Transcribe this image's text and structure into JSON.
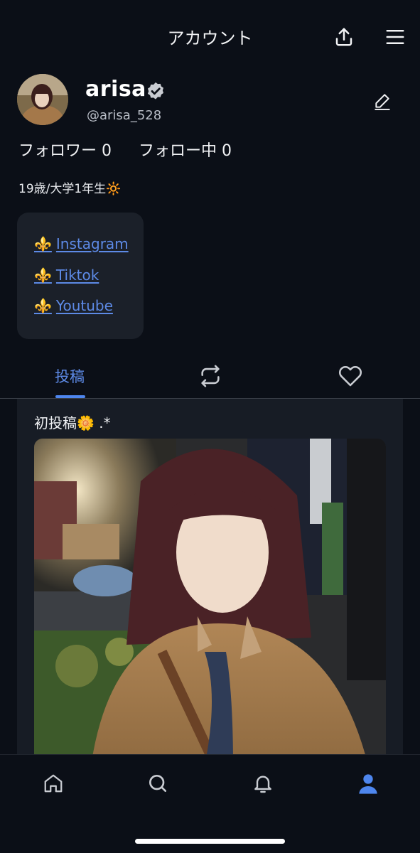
{
  "header": {
    "title": "アカウント"
  },
  "profile": {
    "display_name": "arisa",
    "username": "@arisa_528",
    "followers_label": "フォロワー 0",
    "following_label": "フォロー中 0",
    "bio": "19歳/大学1年生🔆"
  },
  "links": {
    "fleur": "⚜️",
    "items": [
      {
        "label": "Instagram"
      },
      {
        "label": "Tiktok"
      },
      {
        "label": "Youtube"
      }
    ]
  },
  "tabs": {
    "posts_label": "投稿"
  },
  "post": {
    "text": "初投稿🌼 .*"
  },
  "colors": {
    "background": "#0b0f17",
    "card": "#1b2029",
    "accent": "#4e86ee",
    "link": "#5d8ae6"
  },
  "icons": {
    "share": "upload-icon",
    "menu": "hamburger-menu-icon",
    "verified": "verified-badge-icon",
    "edit": "pencil-icon",
    "reposts": "repost-icon",
    "likes": "heart-icon",
    "nav": [
      "home-icon",
      "search-icon",
      "bell-icon",
      "user-icon"
    ]
  }
}
